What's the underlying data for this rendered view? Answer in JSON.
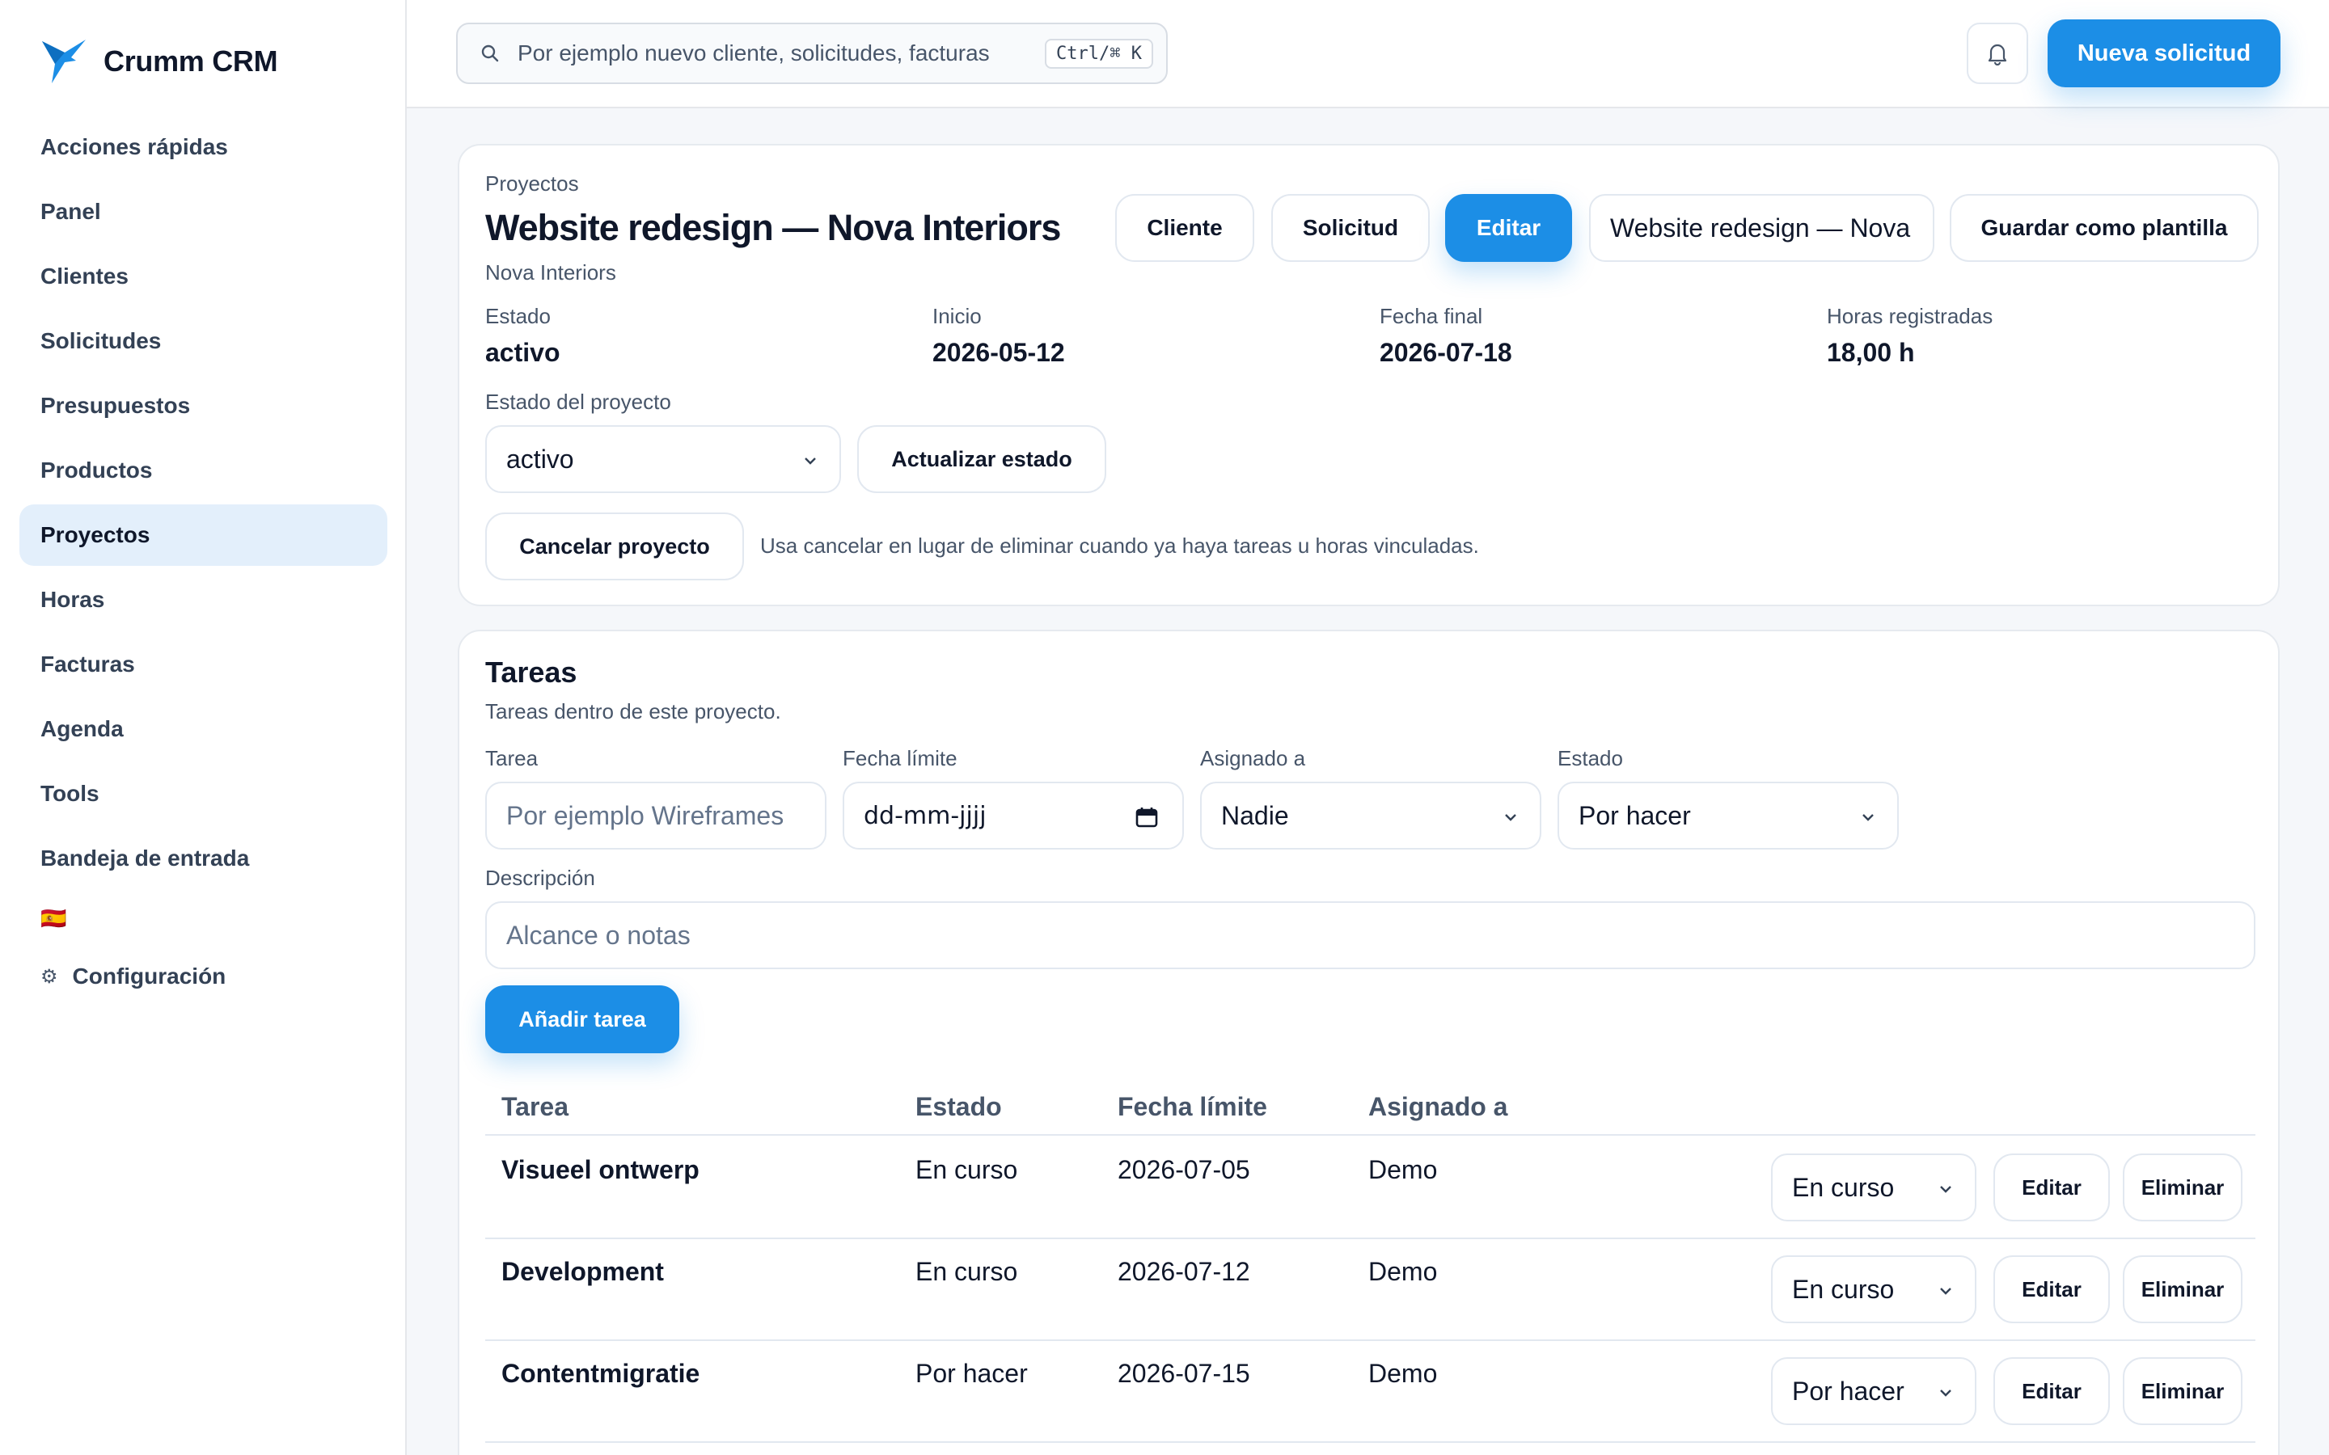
{
  "app": {
    "name": "Crumm CRM"
  },
  "sidebar": {
    "items": [
      {
        "label": "Acciones rápidas"
      },
      {
        "label": "Panel"
      },
      {
        "label": "Clientes"
      },
      {
        "label": "Solicitudes"
      },
      {
        "label": "Presupuestos"
      },
      {
        "label": "Productos"
      },
      {
        "label": "Proyectos",
        "active": true
      },
      {
        "label": "Horas"
      },
      {
        "label": "Facturas"
      },
      {
        "label": "Agenda"
      },
      {
        "label": "Tools"
      },
      {
        "label": "Bandeja de entrada"
      }
    ],
    "language_flag": "🇪🇸",
    "settings_label": "Configuración",
    "settings_icon": "⚙"
  },
  "topbar": {
    "search_placeholder": "Por ejemplo nuevo cliente, solicitudes, facturas",
    "search_shortcut": "Ctrl/⌘ K",
    "new_request_label": "Nueva solicitud"
  },
  "project": {
    "breadcrumb": "Proyectos",
    "title": "Website redesign — Nova Interiors",
    "client": "Nova Interiors",
    "actions": {
      "client": "Cliente",
      "request": "Solicitud",
      "edit": "Editar",
      "template_name_value": "Website redesign — Nova Interiors",
      "save_template": "Guardar como plantilla"
    },
    "stats": {
      "status_label": "Estado",
      "status_value": "activo",
      "start_label": "Inicio",
      "start_value": "2026-05-12",
      "end_label": "Fecha final",
      "end_value": "2026-07-18",
      "hours_label": "Horas registradas",
      "hours_value": "18,00 h"
    },
    "status_field_label": "Estado del proyecto",
    "status_select_value": "activo",
    "update_status_label": "Actualizar estado",
    "cancel_label": "Cancelar proyecto",
    "cancel_hint": "Usa cancelar en lugar de eliminar cuando ya haya tareas u horas vinculadas."
  },
  "tasks": {
    "title": "Tareas",
    "subtitle": "Tareas dentro de este proyecto.",
    "form": {
      "task_label": "Tarea",
      "task_placeholder": "Por ejemplo Wireframes",
      "due_label": "Fecha límite",
      "due_placeholder": "dd-mm-jjjj",
      "assigned_label": "Asignado a",
      "assigned_value": "Nadie",
      "status_label": "Estado",
      "status_value": "Por hacer",
      "description_label": "Descripción",
      "description_placeholder": "Alcance o notas",
      "add_label": "Añadir tarea"
    },
    "columns": {
      "task": "Tarea",
      "status": "Estado",
      "due": "Fecha límite",
      "assigned": "Asignado a"
    },
    "rows": [
      {
        "task": "Visueel ontwerp",
        "status": "En curso",
        "due": "2026-07-05",
        "assigned": "Demo",
        "select": "En curso",
        "edit": "Editar",
        "delete": "Eliminar"
      },
      {
        "task": "Development",
        "status": "En curso",
        "due": "2026-07-12",
        "assigned": "Demo",
        "select": "En curso",
        "edit": "Editar",
        "delete": "Eliminar"
      },
      {
        "task": "Contentmigratie",
        "status": "Por hacer",
        "due": "2026-07-15",
        "assigned": "Demo",
        "select": "Por hacer",
        "edit": "Editar",
        "delete": "Eliminar"
      }
    ]
  },
  "colors": {
    "accent": "#1c8ee6",
    "active_nav": "#e3effb",
    "text": "#0f172a",
    "muted": "#475569"
  }
}
